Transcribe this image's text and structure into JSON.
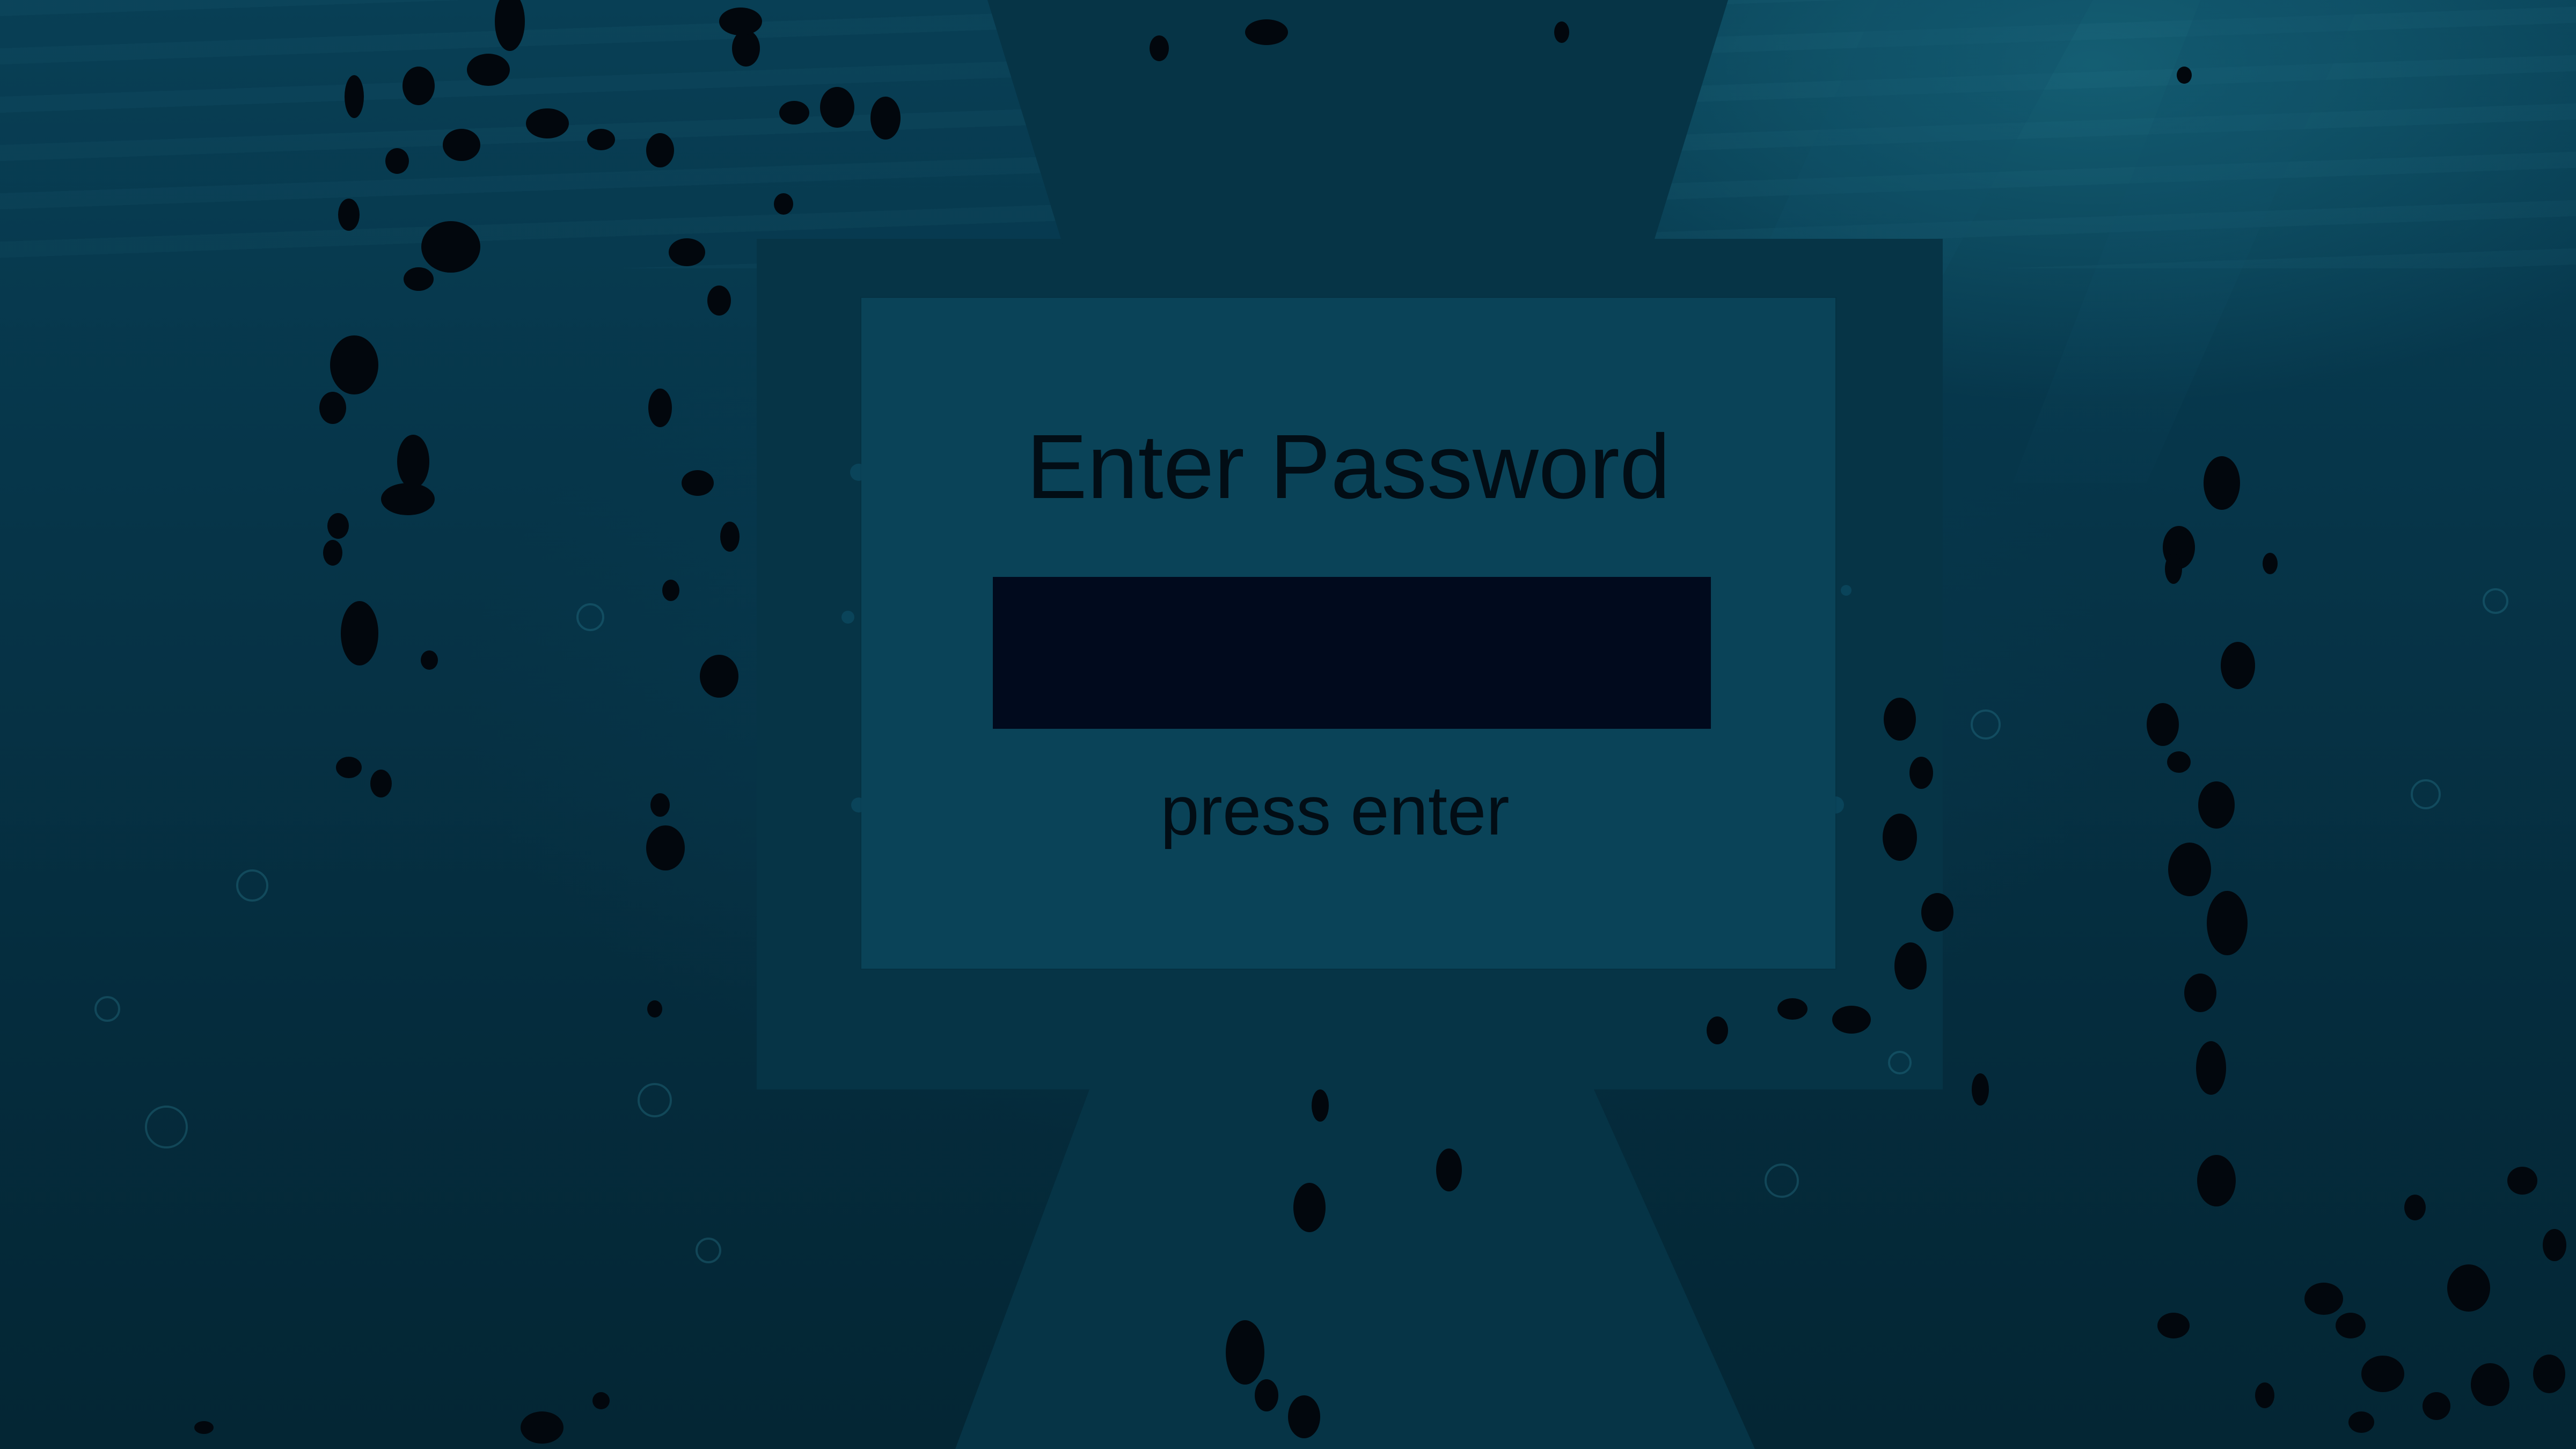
{
  "screen": {
    "title": "Enter Password",
    "hint": "press enter"
  },
  "password_field": {
    "value": "",
    "placeholder": ""
  },
  "colors": {
    "background": "#063549",
    "panel": "#0a4358",
    "frame": "#063446",
    "input": "#010a1d",
    "text": "#020d15"
  }
}
